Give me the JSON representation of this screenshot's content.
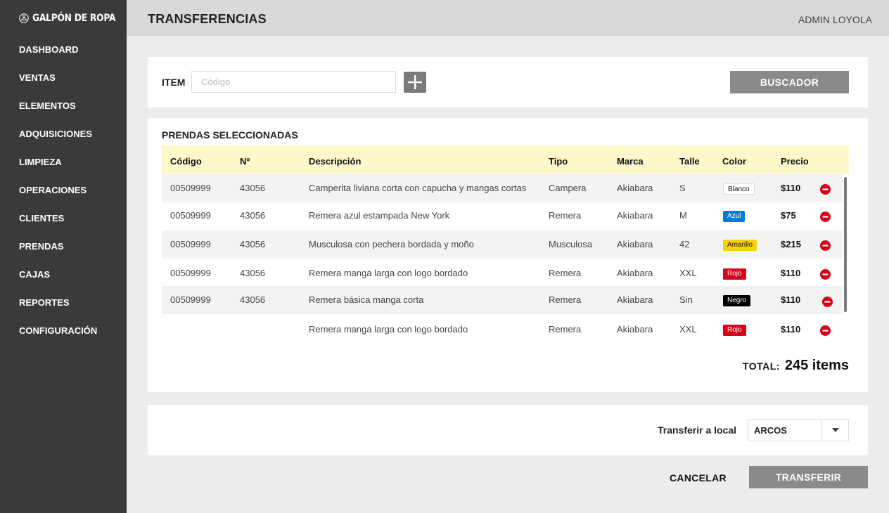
{
  "app": {
    "brand": "GALPÓN DE ROPA",
    "logo_icon": "hanger-icon"
  },
  "sidebar": {
    "items": [
      {
        "label": "DASHBOARD"
      },
      {
        "label": "VENTAS"
      },
      {
        "label": "ELEMENTOS"
      },
      {
        "label": "ADQUISICIONES"
      },
      {
        "label": "LIMPIEZA"
      },
      {
        "label": "OPERACIONES"
      },
      {
        "label": "CLIENTES"
      },
      {
        "label": "PRENDAS"
      },
      {
        "label": "CAJAS"
      },
      {
        "label": "REPORTES"
      },
      {
        "label": "CONFIGURACIÓN"
      }
    ]
  },
  "header": {
    "title": "TRANSFERENCIAS",
    "user": "ADMIN LOYOLA"
  },
  "item_entry": {
    "label": "ITEM",
    "placeholder": "Código",
    "value": "",
    "add_icon": "plus-icon",
    "search_label": "BUSCADOR"
  },
  "selected": {
    "title": "PRENDAS SELECCIONADAS",
    "columns": [
      "Código",
      "Nº",
      "Descripción",
      "Tipo",
      "Marca",
      "Talle",
      "Color",
      "Precio"
    ],
    "rows": [
      {
        "codigo": "00509999",
        "numero": "43056",
        "descripcion": "Camperita liviana corta con capucha y mangas cortas",
        "tipo": "Campera",
        "marca": "Akiabara",
        "talle": "S",
        "color": "Blanco",
        "color_bg": "#ffffff",
        "color_fg": "#111111",
        "precio": "$110"
      },
      {
        "codigo": "00509999",
        "numero": "43056",
        "descripcion": "Remera azul estampada New York",
        "tipo": "Remera",
        "marca": "Akiabara",
        "talle": "M",
        "color": "Azul",
        "color_bg": "#0a7ad1",
        "color_fg": "#ffffff",
        "precio": "$75"
      },
      {
        "codigo": "00509999",
        "numero": "43056",
        "descripcion": "Musculosa con pechera bordada y moño",
        "tipo": "Musculosa",
        "marca": "Akiabara",
        "talle": "42",
        "color": "Amarillo",
        "color_bg": "#f5d20a",
        "color_fg": "#111111",
        "precio": "$215"
      },
      {
        "codigo": "00509999",
        "numero": "43056",
        "descripcion": "Remera manga larga con logo bordado",
        "tipo": "Remera",
        "marca": "Akiabara",
        "talle": "XXL",
        "color": "Rojo",
        "color_bg": "#d7001a",
        "color_fg": "#ffffff",
        "precio": "$110"
      },
      {
        "codigo": "00509999",
        "numero": "43056",
        "descripcion": "Remera básica manga corta",
        "tipo": "Remera",
        "marca": "Akiabara",
        "talle": "Sin",
        "color": "Negro",
        "color_bg": "#000000",
        "color_fg": "#ffffff",
        "precio": "$110"
      },
      {
        "codigo": "",
        "numero": "",
        "descripcion": "Remera manga larga con logo bordado",
        "tipo": "Remera",
        "marca": "Akiabara",
        "talle": "XXL",
        "color": "Rojo",
        "color_bg": "#d7001a",
        "color_fg": "#ffffff",
        "precio": "$110"
      }
    ],
    "remove_icon": "minus-circle-icon",
    "total_label": "TOTAL:",
    "total_value": "245 items"
  },
  "transfer": {
    "label": "Transferir a local",
    "selected_value": "ARCOS",
    "dropdown_icon": "caret-down-icon"
  },
  "actions": {
    "cancel_label": "CANCELAR",
    "transfer_label": "TRANSFERIR"
  },
  "colors": {
    "sidebar_bg": "#3a3a3a",
    "header_bg": "#d9d9d9",
    "table_header_bg": "#fdf8c9",
    "button_bg": "#8a8a8a",
    "remove_red": "#d7001a"
  }
}
